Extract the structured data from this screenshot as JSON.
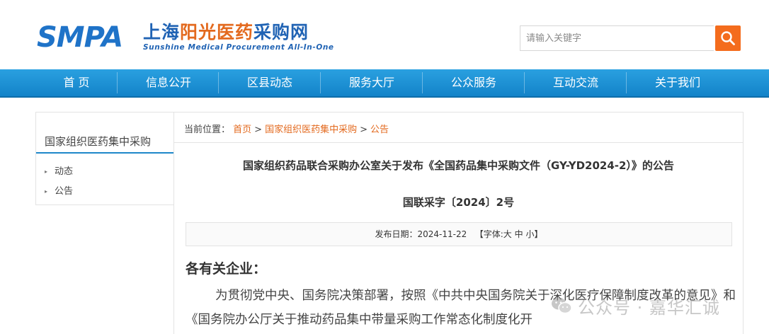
{
  "header": {
    "logo_text": "SMPA",
    "logo_cn_part1": "上海",
    "logo_cn_part2": "阳光医药",
    "logo_cn_part3": "采购网",
    "logo_en": "Sunshine Medical Procurement All-In-One",
    "search_placeholder": "请输入关键字"
  },
  "nav": {
    "items": [
      "首 页",
      "信息公开",
      "区县动态",
      "服务大厅",
      "公众服务",
      "互动交流",
      "关于我们"
    ]
  },
  "sidebar": {
    "title": "国家组织医药集中采购",
    "items": [
      "动态",
      "公告"
    ]
  },
  "breadcrumb": {
    "prefix": "当前位置：",
    "items": [
      "首页",
      "国家组织医药集中采购",
      "公告"
    ],
    "separator": ">"
  },
  "article": {
    "title": "国家组织药品联合采购办公室关于发布《全国药品集中采购文件（GY-YD2024-2）》的公告",
    "doc_number": "国联采字〔2024〕2号",
    "date_label": "发布日期：",
    "date": "2024-11-22",
    "font_label_open": "【字体:",
    "font_large": "大",
    "font_medium": "中",
    "font_small": "小",
    "font_label_close": "】",
    "greeting": "各有关企业：",
    "paragraph": "为贯彻党中央、国务院决策部署，按照《中共中央国务院关于深化医疗保障制度改革的意见》和《国务院办公厅关于推动药品集中带量采购工作常态化制度化开"
  },
  "watermark": {
    "text": "公众号 · 嘉华汇诚"
  },
  "colors": {
    "brand_blue": "#1f73c8",
    "accent_orange": "#f46c1d",
    "nav_blue": "#1a8fd4"
  }
}
